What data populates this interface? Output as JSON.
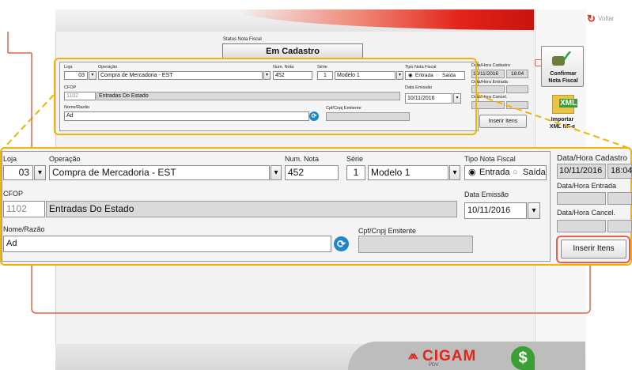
{
  "header": {
    "back_label": "Voltar"
  },
  "status": {
    "label": "Status Nota Fiscal",
    "value": "Em Cadastro"
  },
  "form": {
    "loja_label": "Loja",
    "loja_value": "03",
    "operacao_label": "Operação",
    "operacao_value": "Compra de Mercadoria - EST",
    "num_nota_label": "Num. Nota",
    "num_nota_value": "452",
    "serie_label": "Série",
    "serie_value": "1",
    "modelo_value": "Modelo 1",
    "tipo_label": "Tipo Nota Fiscal",
    "tipo_entrada": "Entrada",
    "tipo_saida": "Saída",
    "cfop_label": "CFOP",
    "cfop_code": "1102",
    "cfop_desc": "Entradas Do Estado",
    "emissao_label": "Data Emissão",
    "emissao_value": "10/11/2016",
    "nome_label": "Nome/Razão",
    "nome_value": "Ad",
    "cnpj_label": "Cpf/Cnpj Emitente",
    "cnpj_value": "",
    "cadastro_label": "Data/Hora Cadastro",
    "cadastro_date": "10/11/2016",
    "cadastro_time": "18:04",
    "entrada_label": "Data/Hora Entrada",
    "cancel_label": "Data/Hora Cancel.",
    "inserir_label": "Inserir Itens"
  },
  "sidebar": {
    "confirmar_line1": "Confirmar",
    "confirmar_line2": "Nota Fiscal",
    "importar_line1": "Importar",
    "importar_line2": "XML NF-e",
    "xml_badge": "XML"
  },
  "brand": {
    "name": "CIGAM",
    "sub": "PDV",
    "symbol": "$"
  },
  "colors": {
    "accent_red": "#e2241a",
    "highlight_orange": "#f2b400",
    "callout_red": "#e8604a"
  }
}
